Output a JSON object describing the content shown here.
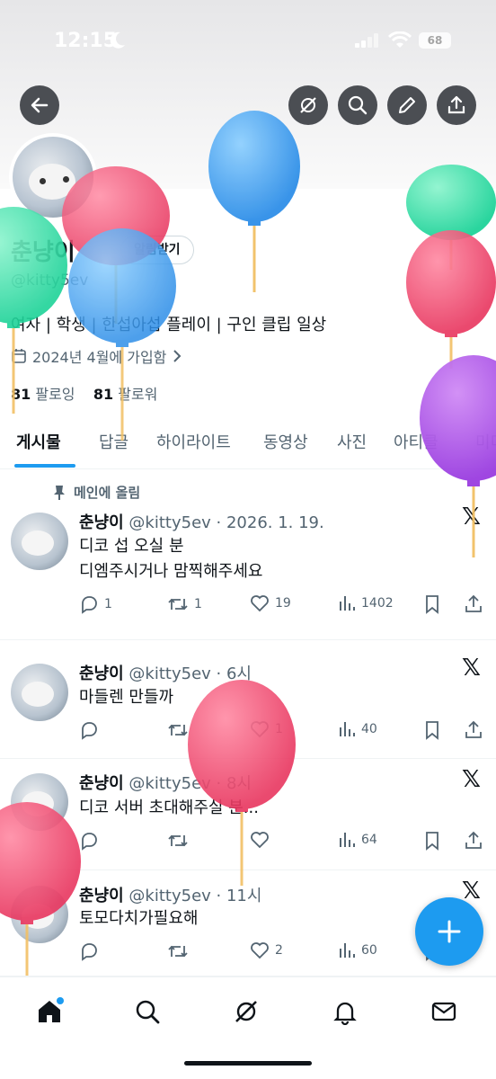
{
  "status_bar": {
    "time": "12:15",
    "battery": "68"
  },
  "profile": {
    "name": "춘냥이",
    "subscribe_label": "알림받기",
    "handle": "@kitty5ev",
    "bio": "여자 | 학생 | 한섭아섭 플레이 | 구인 클립 일상",
    "joined": "2024년 4월에 가입함",
    "following_count": "81",
    "following_label": "팔로잉",
    "followers_count": "81",
    "followers_label": "팔로워"
  },
  "tabs": [
    "게시물",
    "답글",
    "하이라이트",
    "동영상",
    "사진",
    "아티클",
    "미디어"
  ],
  "pinned_label": "메인에 올림",
  "posts": [
    {
      "name": "춘냥이",
      "meta": "@kitty5ev · 2026. 1. 19.",
      "text1": "디코 섭 오실 분",
      "text2": "디엠주시거나 맘찍해주세요",
      "replies": "1",
      "reposts": "1",
      "likes": "19",
      "views": "1402"
    },
    {
      "name": "춘냥이",
      "meta": "@kitty5ev · 6시",
      "text1": "마들렌 만들까",
      "replies": "",
      "reposts": "",
      "likes": "1",
      "views": "40"
    },
    {
      "name": "춘냥이",
      "meta": "@kitty5ev · 8시",
      "text1": "디코 서버 초대해주실 분...",
      "replies": "",
      "reposts": "",
      "likes": "",
      "views": "64"
    },
    {
      "name": "춘냥이",
      "meta": "@kitty5ev · 11시",
      "text1": "토모다치가필요해",
      "replies": "",
      "reposts": "",
      "likes": "2",
      "views": "60"
    }
  ],
  "icons": {
    "back": "back-arrow-icon",
    "grok": "grok-icon",
    "search": "search-icon",
    "edit": "pencil-icon",
    "share": "share-icon",
    "x": "x-logo-icon",
    "compose": "plus-icon",
    "home": "home-icon",
    "notifications": "bell-icon",
    "messages": "mail-icon"
  },
  "colors": {
    "accent": "#1d9bf0",
    "text": "#0f1419",
    "secondary": "#536471"
  }
}
